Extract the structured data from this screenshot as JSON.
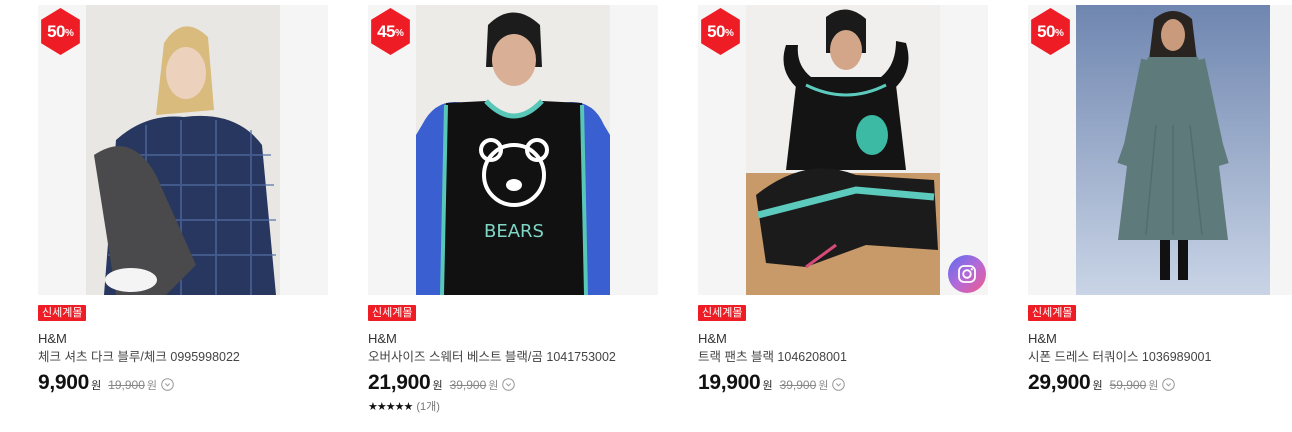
{
  "products": [
    {
      "discount": "50",
      "percent_sign": "%",
      "tag": "신세계몰",
      "brand": "H&M",
      "name": "체크 셔츠 다크 블루/체크 0995998022",
      "price": "9,900",
      "price_unit": "원",
      "original_price": "19,900",
      "original_unit": "원"
    },
    {
      "discount": "45",
      "percent_sign": "%",
      "tag": "신세계몰",
      "brand": "H&M",
      "name": "오버사이즈 스웨터 베스트 블랙/곰 1041753002",
      "price": "21,900",
      "price_unit": "원",
      "original_price": "39,900",
      "original_unit": "원",
      "rating": {
        "stars": "★★★★★",
        "count": "(1개)"
      }
    },
    {
      "discount": "50",
      "percent_sign": "%",
      "tag": "신세계몰",
      "brand": "H&M",
      "name": "트랙 팬츠 블랙 1046208001",
      "price": "19,900",
      "price_unit": "원",
      "original_price": "39,900",
      "original_unit": "원"
    },
    {
      "discount": "50",
      "percent_sign": "%",
      "tag": "신세계몰",
      "brand": "H&M",
      "name": "시폰 드레스 터쿼이스 1036989001",
      "price": "29,900",
      "price_unit": "원",
      "original_price": "59,900",
      "original_unit": "원"
    }
  ],
  "colors": {
    "accent_red": "#ee1c25"
  },
  "icons": [
    "info-icon",
    "instagram-icon",
    "star-icon"
  ]
}
